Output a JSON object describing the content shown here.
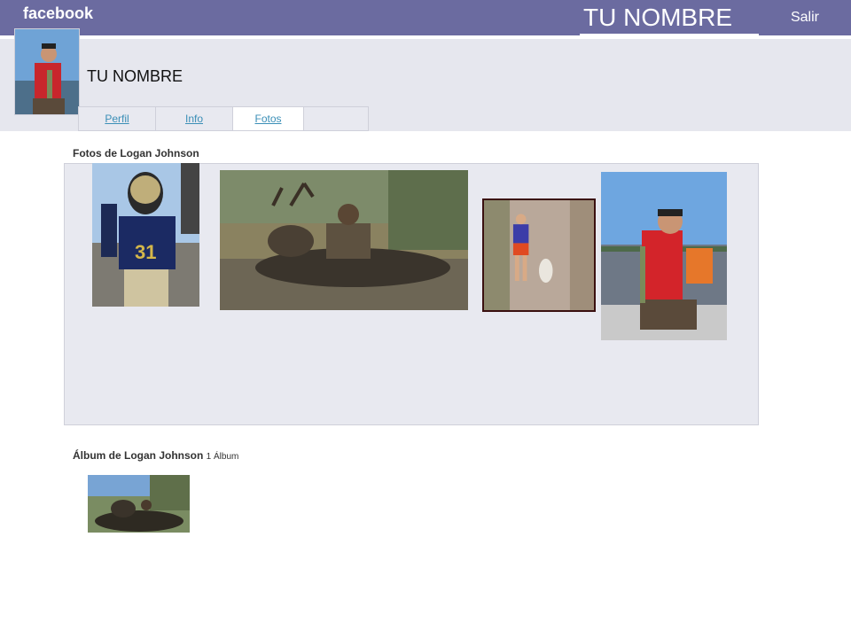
{
  "app": {
    "logo": "facebook",
    "user_name": "TU NOMBRE",
    "logout_label": "Salir"
  },
  "profile": {
    "name": "TU NOMBRE"
  },
  "tabs": [
    {
      "label": "Perfil"
    },
    {
      "label": "Info"
    },
    {
      "label": "Fotos"
    }
  ],
  "photos_section": {
    "title": "Fotos de Logan Johnson"
  },
  "albums_section": {
    "title": "Álbum de Logan Johnson",
    "count": "1 Álbum"
  },
  "colors": {
    "topbar": "#6b6ba0",
    "band": "#e6e7ee",
    "link": "#3b8fb7"
  }
}
